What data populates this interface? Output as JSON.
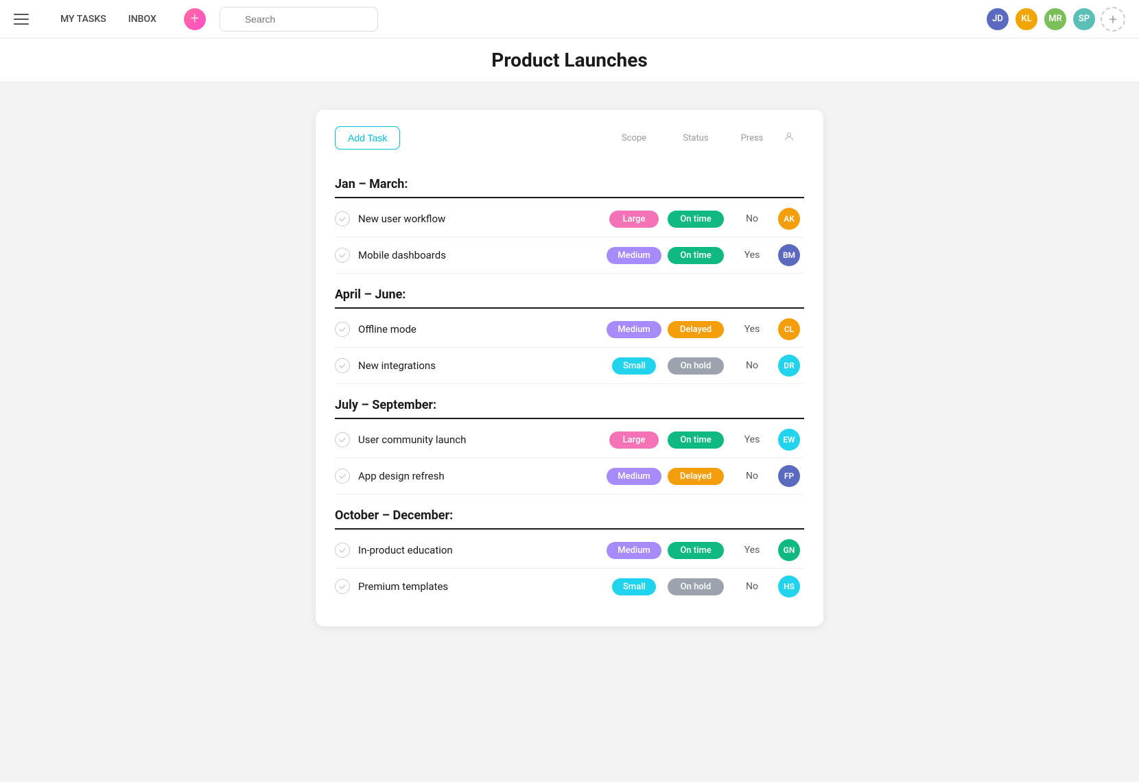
{
  "nav": {
    "my_tasks": "MY TASKS",
    "inbox": "INBOX",
    "add_btn": "+",
    "search_placeholder": "Search"
  },
  "header_avatars": [
    {
      "id": "av1",
      "initials": "JD",
      "color": "#5b6abf"
    },
    {
      "id": "av2",
      "initials": "KL",
      "color": "#f0a500"
    },
    {
      "id": "av3",
      "initials": "MR",
      "color": "#7bbf5b"
    },
    {
      "id": "av4",
      "initials": "SP",
      "color": "#5bbfb5"
    }
  ],
  "page_title": "Product Launches",
  "add_task_label": "Add Task",
  "columns": {
    "scope": "Scope",
    "status": "Status",
    "press": "Press",
    "person": ""
  },
  "sections": [
    {
      "id": "q1",
      "title": "Jan – March:",
      "tasks": [
        {
          "id": "t1",
          "name": "New user workflow",
          "scope": "Large",
          "scope_class": "badge-large",
          "status": "On time",
          "status_class": "badge-ontime",
          "press": "No",
          "avatar_color": "#f59e0b",
          "avatar_initials": "AK"
        },
        {
          "id": "t2",
          "name": "Mobile dashboards",
          "scope": "Medium",
          "scope_class": "badge-medium",
          "status": "On time",
          "status_class": "badge-ontime",
          "press": "Yes",
          "avatar_color": "#5b6abf",
          "avatar_initials": "BM"
        }
      ]
    },
    {
      "id": "q2",
      "title": "April – June:",
      "tasks": [
        {
          "id": "t3",
          "name": "Offline mode",
          "scope": "Medium",
          "scope_class": "badge-medium",
          "status": "Delayed",
          "status_class": "badge-delayed",
          "press": "Yes",
          "avatar_color": "#f59e0b",
          "avatar_initials": "CL"
        },
        {
          "id": "t4",
          "name": "New integrations",
          "scope": "Small",
          "scope_class": "badge-small",
          "status": "On hold",
          "status_class": "badge-onhold",
          "press": "No",
          "avatar_color": "#22d3ee",
          "avatar_initials": "DR"
        }
      ]
    },
    {
      "id": "q3",
      "title": "July – September:",
      "tasks": [
        {
          "id": "t5",
          "name": "User community launch",
          "scope": "Large",
          "scope_class": "badge-large",
          "status": "On time",
          "status_class": "badge-ontime",
          "press": "Yes",
          "avatar_color": "#22d3ee",
          "avatar_initials": "EW"
        },
        {
          "id": "t6",
          "name": "App design refresh",
          "scope": "Medium",
          "scope_class": "badge-medium",
          "status": "Delayed",
          "status_class": "badge-delayed",
          "press": "No",
          "avatar_color": "#5b6abf",
          "avatar_initials": "FP"
        }
      ]
    },
    {
      "id": "q4",
      "title": "October – December:",
      "tasks": [
        {
          "id": "t7",
          "name": "In-product education",
          "scope": "Medium",
          "scope_class": "badge-medium",
          "status": "On time",
          "status_class": "badge-ontime",
          "press": "Yes",
          "avatar_color": "#10b981",
          "avatar_initials": "GN"
        },
        {
          "id": "t8",
          "name": "Premium templates",
          "scope": "Small",
          "scope_class": "badge-small",
          "status": "On hold",
          "status_class": "badge-onhold",
          "press": "No",
          "avatar_color": "#22d3ee",
          "avatar_initials": "HS"
        }
      ]
    }
  ]
}
